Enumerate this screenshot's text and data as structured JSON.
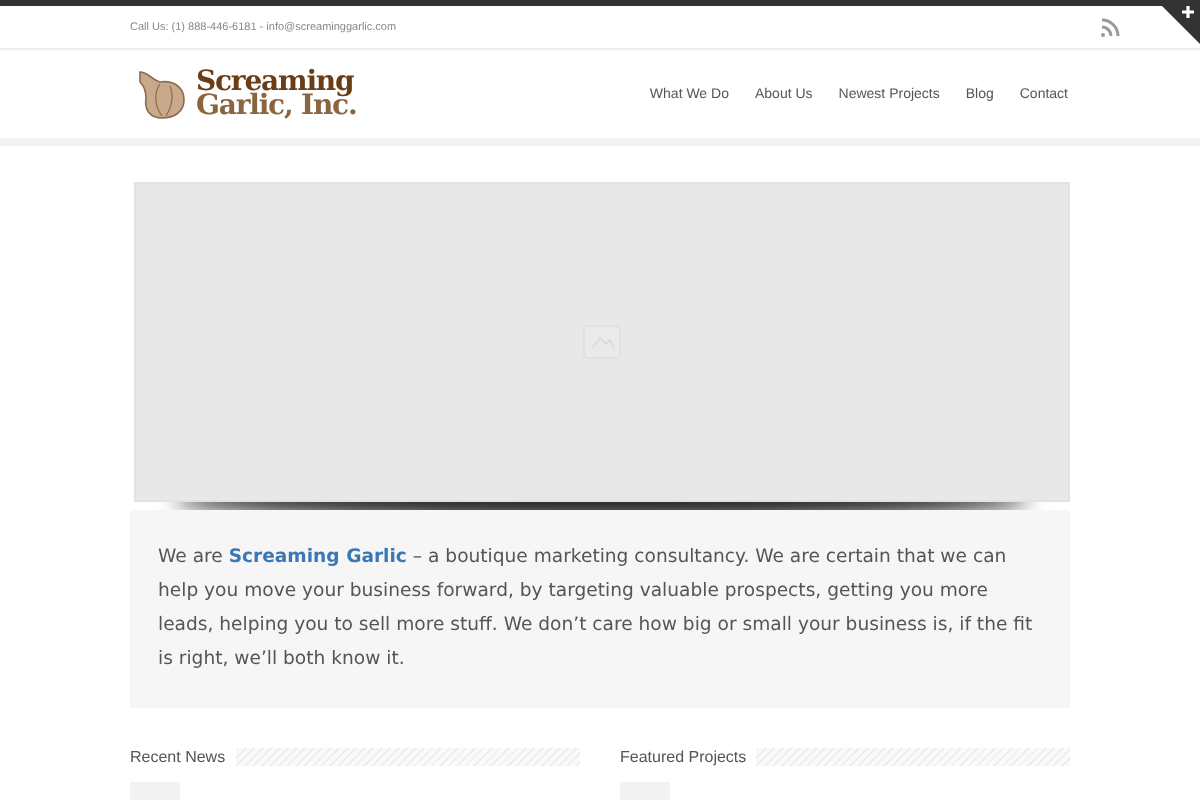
{
  "top_bar": {
    "contact": "Call Us: (1) 888-446-6181 - info@screaminggarlic.com"
  },
  "logo": {
    "line_1": "Screaming",
    "line_2": "Garlic, Inc."
  },
  "nav": [
    {
      "label": "What We Do"
    },
    {
      "label": "About Us"
    },
    {
      "label": "Newest Projects"
    },
    {
      "label": "Blog"
    },
    {
      "label": "Contact"
    }
  ],
  "intro": "We are **Screaming Garlic** – a boutique marketing consultancy. We are certain that we can help you move your business forward, by targeting valuable prospects, getting you more leads, helping you to sell more stuff. We don’t care how big or small your business is, if the fit is right, we’ll both know it.",
  "sections": [
    {
      "title": "Recent News"
    },
    {
      "title": "Featured Projects"
    }
  ]
}
